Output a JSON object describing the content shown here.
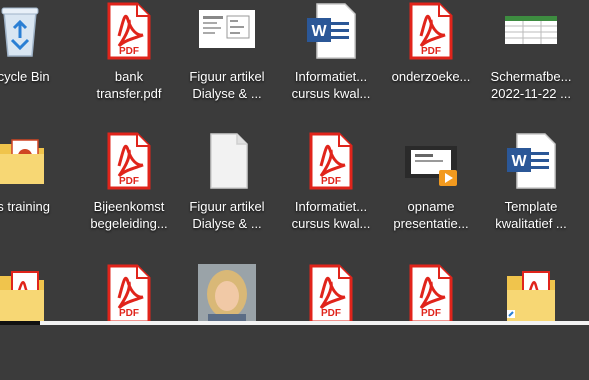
{
  "colors": {
    "desktop_bg": "#3b3b3b",
    "pdf_red": "#e0241b",
    "word_blue": "#2b5797",
    "folder_yellow": "#f0c44c"
  },
  "desktop_icons": [
    {
      "icon": "recycle-bin-icon",
      "line1": "ecycle Bin",
      "line2": ""
    },
    {
      "icon": "pdf-icon",
      "line1": "bank",
      "line2": "transfer.pdf"
    },
    {
      "icon": "document-thumbnail-icon",
      "line1": "Figuur artikel",
      "line2": "Dialyse & ..."
    },
    {
      "icon": "word-icon",
      "line1": "Informatiet...",
      "line2": "cursus kwal..."
    },
    {
      "icon": "pdf-icon",
      "line1": "onderzoeke...",
      "line2": ""
    },
    {
      "icon": "spreadsheet-thumbnail-icon",
      "line1": "Schermafbe...",
      "line2": "2022-11-22 ..."
    },
    {
      "icon": "powerpoint-folder-icon",
      "line1": "as training",
      "line2": ""
    },
    {
      "icon": "pdf-icon",
      "line1": "Bijeenkomst",
      "line2": "begeleiding..."
    },
    {
      "icon": "blank-file-icon",
      "line1": "Figuur artikel",
      "line2": "Dialyse & ..."
    },
    {
      "icon": "pdf-icon",
      "line1": "Informatiet...",
      "line2": "cursus kwal..."
    },
    {
      "icon": "video-icon",
      "line1": "opname",
      "line2": "presentatie..."
    },
    {
      "icon": "word-icon",
      "line1": "Template",
      "line2": "kwalitatief ..."
    },
    {
      "icon": "pdf-folder-icon",
      "line1": "",
      "line2": ""
    },
    {
      "icon": "pdf-icon",
      "line1": "",
      "line2": ""
    },
    {
      "icon": "photo-icon",
      "line1": "",
      "line2": ""
    },
    {
      "icon": "pdf-icon",
      "line1": "",
      "line2": ""
    },
    {
      "icon": "pdf-icon",
      "line1": "",
      "line2": ""
    },
    {
      "icon": "pdf-folder-icon",
      "line1": "",
      "line2": ""
    }
  ],
  "pdf_badge": "PDF",
  "word_badge": "W"
}
